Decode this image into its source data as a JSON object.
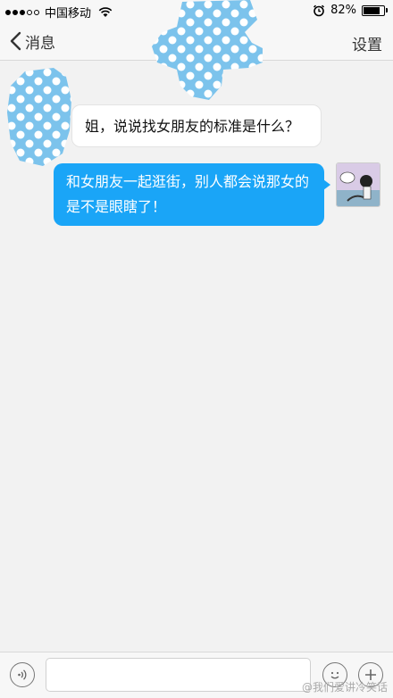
{
  "status_bar": {
    "carrier": "中国移动",
    "battery_text": "82%",
    "battery_level": 0.82,
    "signal_bars_filled": 3,
    "signal_bars_total": 5
  },
  "nav": {
    "back_label": "消息",
    "settings_label": "设置"
  },
  "messages": [
    {
      "direction": "incoming",
      "text": "姐，说说找女朋友的标准是什么？"
    },
    {
      "direction": "outgoing",
      "text": "和女朋友一起逛街，别人都会说那女的是不是眼瞎了！"
    }
  ],
  "input_bar": {
    "placeholder": "",
    "value": ""
  },
  "watermark": {
    "text": "@我们爱讲冷笑话"
  },
  "colors": {
    "outgoing_bubble": "#1aa5f7",
    "polka_mask": "#7cc3ec"
  },
  "icons": [
    "back-chevron-icon",
    "wifi-icon",
    "alarm-icon",
    "battery-icon",
    "voice-icon",
    "emoji-icon",
    "plus-icon"
  ]
}
